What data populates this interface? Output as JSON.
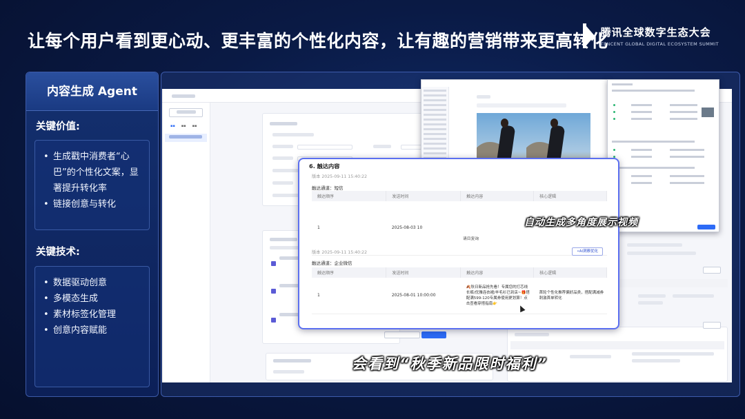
{
  "headline": "让每个用户看到更心动、更丰富的个性化内容，让有趣的营销带来更高转化",
  "brand": {
    "name_cn": "腾讯全球数字生态大会",
    "name_en": "TENCENT GLOBAL DIGITAL ECOSYSTEM SUMMIT"
  },
  "left_panel": {
    "title": "内容生成 Agent",
    "value_label": "关键价值:",
    "values": [
      "生成戳中消费者“心巴”的个性化文案，显著提升转化率",
      "链接创意与转化"
    ],
    "tech_label": "关键技术:",
    "techs": [
      "数据驱动创意",
      "多模态生成",
      "素材标签化管理",
      "创意内容赋能"
    ]
  },
  "popup": {
    "title": "6. 触达内容",
    "sms_version": "版本 2025-09-11 15:40:22",
    "sms_channel": "触达通道：短信",
    "wechat_version": "版本 2025-09-11 15:40:22",
    "wechat_channel": "触达通道：企业微信",
    "detail_button": "•AI洞察优化",
    "columns": [
      "触达顺序",
      "发送时间",
      "触达内容",
      "核心逻辑"
    ],
    "sms_row": {
      "order": "1",
      "time": "2025-08-03 10"
    },
    "wechat_row": {
      "order": "1",
      "time": "2025-08-01 10:00:00",
      "content": "🍂秋日新品抢先看！专属您的打芯线长裤/优雅连衣裙/羊毛衫已到店~🎁搭配满599-120专属券使用更划算！点击查看穿搭指南👉",
      "logic": "首轮个性化推荐偏好品类，搭配满减券刺激首单转化"
    },
    "partial_text": "请目复询"
  },
  "subtitles": {
    "top": "自动生成多角度展示视频",
    "bottom": "会看到“秋季新品限时福利”"
  }
}
